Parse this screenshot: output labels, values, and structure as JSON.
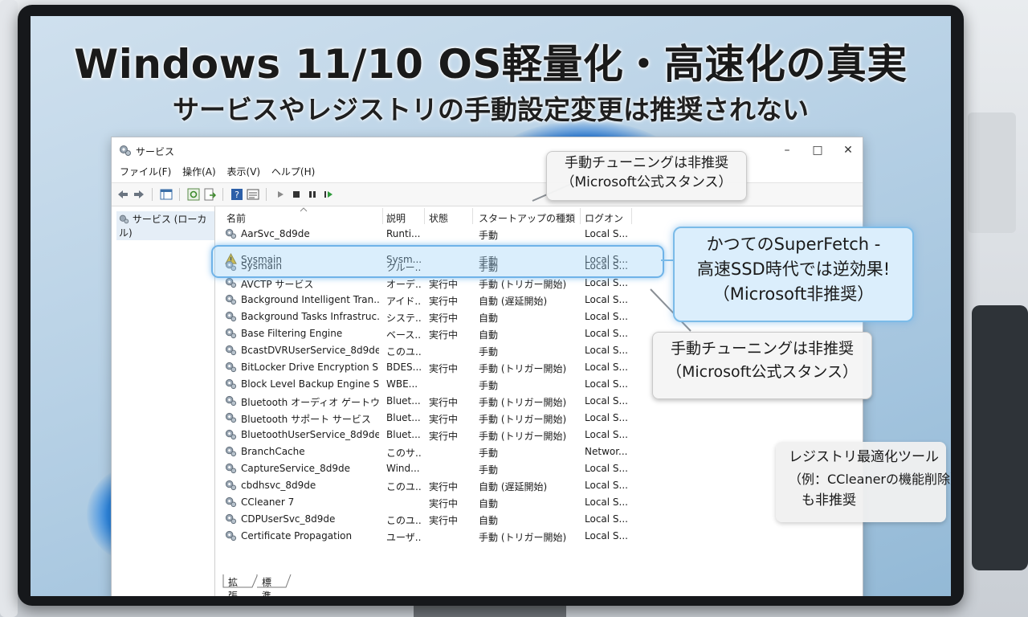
{
  "slide": {
    "title": "Windows 11/10 OS軽量化・高速化の真実",
    "subtitle": "サービスやレジストリの手動設定変更は推奨されない"
  },
  "window": {
    "title": "サービス",
    "controls": {
      "minimize": "–",
      "maximize": "□",
      "close": "✕"
    },
    "menu": [
      "ファイル(F)",
      "操作(A)",
      "表示(V)",
      "ヘルプ(H)"
    ],
    "tree_item": "サービス (ローカル)",
    "columns": [
      "名前",
      "説明",
      "状態",
      "スタートアップの種類",
      "ログオン"
    ],
    "rows": [
      {
        "name": "AarSvc_8d9de",
        "desc": "Runti...",
        "status": "",
        "startup": "手動",
        "logon": "Local S..."
      },
      {
        "name": "Sysmain",
        "desc": "Sysm...",
        "status": "",
        "startup": "手動",
        "logon": "Local S..."
      },
      {
        "name": "Sysmain",
        "desc": "クルー...",
        "status": "",
        "startup": "手動",
        "logon": "Local S..."
      },
      {
        "name": "AVCTP サービス",
        "desc": "オーデ...",
        "status": "実行中",
        "startup": "手動 (トリガー開始)",
        "logon": "Local S..."
      },
      {
        "name": "Background Intelligent Tran...",
        "desc": "アイド...",
        "status": "実行中",
        "startup": "自動 (遅延開始)",
        "logon": "Local S..."
      },
      {
        "name": "Background Tasks Infrastruc...",
        "desc": "システ...",
        "status": "実行中",
        "startup": "自動",
        "logon": "Local S..."
      },
      {
        "name": "Base Filtering Engine",
        "desc": "ベース...",
        "status": "実行中",
        "startup": "自動",
        "logon": "Local S..."
      },
      {
        "name": "BcastDVRUserService_8d9de",
        "desc": "このユ...",
        "status": "",
        "startup": "手動",
        "logon": "Local S..."
      },
      {
        "name": "BitLocker Drive Encryption S...",
        "desc": "BDES...",
        "status": "実行中",
        "startup": "手動 (トリガー開始)",
        "logon": "Local S..."
      },
      {
        "name": "Block Level Backup Engine S...",
        "desc": "WBE...",
        "status": "",
        "startup": "手動",
        "logon": "Local S..."
      },
      {
        "name": "Bluetooth オーディオ ゲートウェイ...",
        "desc": "Bluet...",
        "status": "実行中",
        "startup": "手動 (トリガー開始)",
        "logon": "Local S..."
      },
      {
        "name": "Bluetooth サポート サービス",
        "desc": "Bluet...",
        "status": "実行中",
        "startup": "手動 (トリガー開始)",
        "logon": "Local S..."
      },
      {
        "name": "BluetoothUserService_8d9de",
        "desc": "Bluet...",
        "status": "実行中",
        "startup": "手動 (トリガー開始)",
        "logon": "Local S..."
      },
      {
        "name": "BranchCache",
        "desc": "このサ...",
        "status": "",
        "startup": "手動",
        "logon": "Networ..."
      },
      {
        "name": "CaptureService_8d9de",
        "desc": "Wind...",
        "status": "",
        "startup": "手動",
        "logon": "Local S..."
      },
      {
        "name": "cbdhsvc_8d9de",
        "desc": "このユ...",
        "status": "実行中",
        "startup": "自動 (遅延開始)",
        "logon": "Local S..."
      },
      {
        "name": "CCleaner 7",
        "desc": "",
        "status": "実行中",
        "startup": "自動",
        "logon": "Local S..."
      },
      {
        "name": "CDPUserSvc_8d9de",
        "desc": "このユ...",
        "status": "実行中",
        "startup": "自動",
        "logon": "Local S..."
      },
      {
        "name": "Certificate Propagation",
        "desc": "ユーザ...",
        "status": "",
        "startup": "手動 (トリガー開始)",
        "logon": "Local S..."
      }
    ],
    "tabs": [
      "拡張",
      "標準"
    ]
  },
  "callouts": {
    "top": {
      "line1": "手動チューニングは非推奨",
      "line2": "（Microsoft公式スタンス）"
    },
    "superfetch": {
      "line1": "かつてのSuperFetch -",
      "line2": "高速SSD時代では逆効果!",
      "line3": "（Microsoft非推奨）"
    },
    "middle": {
      "line1": "手動チューニングは非推奨",
      "line2": "（Microsoft公式スタンス）"
    },
    "registry": {
      "line1": "レジストリ最適化ツール",
      "line2": "（例：CCleanerの機能削除）",
      "line3": "も非推奨"
    }
  },
  "colors": {
    "highlight": "#6fb3e8",
    "callout_blue_bg": "#dbeefc",
    "warning": "#e8b400"
  }
}
